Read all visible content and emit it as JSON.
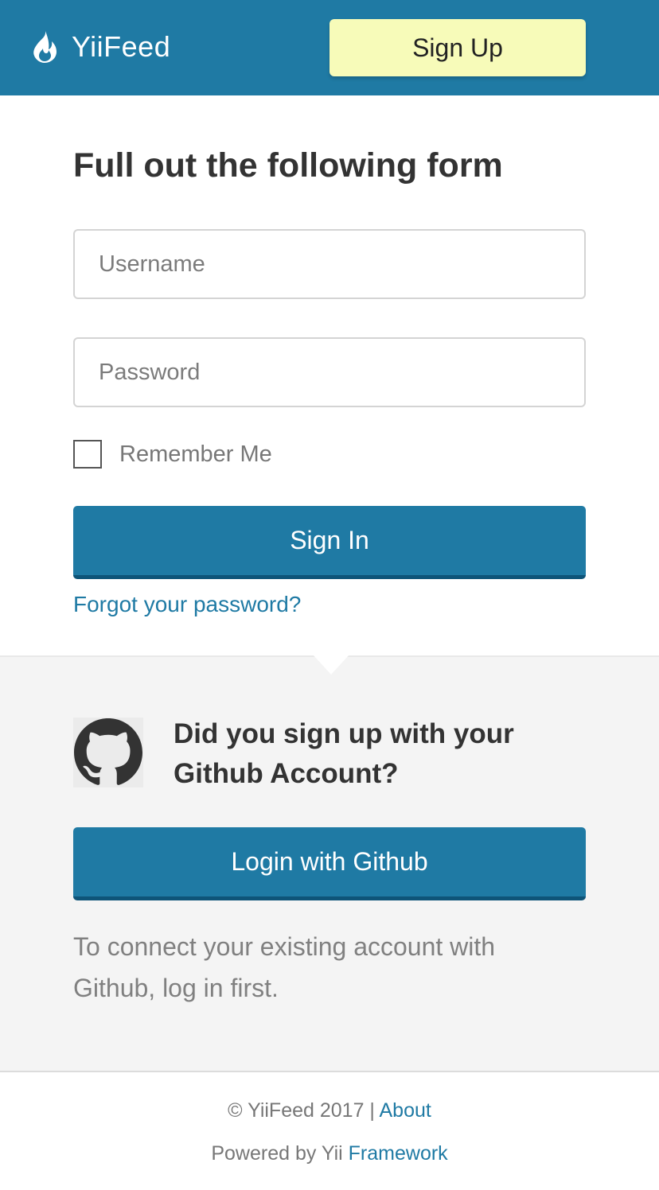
{
  "header": {
    "brand_name": "YiiFeed",
    "brand_icon": "flame-icon",
    "signup_label": "Sign Up",
    "colors": {
      "header_bg": "#1f7aa4",
      "signup_bg": "#f7fbb9"
    }
  },
  "login_form": {
    "title": "Full out the following form",
    "username_placeholder": "Username",
    "username_value": "",
    "password_placeholder": "Password",
    "password_value": "",
    "remember_label": "Remember Me",
    "remember_checked": false,
    "signin_label": "Sign In",
    "forgot_label": "Forgot your password?",
    "colors": {
      "primary": "#1f7aa4",
      "link": "#1f7aa4"
    }
  },
  "github": {
    "icon": "github-icon",
    "question": "Did you sign up with your Github Account?",
    "login_label": "Login with Github",
    "note": "To connect your existing account with Github, log in first.",
    "colors": {
      "section_bg": "#f4f4f4"
    }
  },
  "footer": {
    "copyright": "© YiiFeed 2017 |",
    "about_label": "About",
    "powered_prefix": "Powered by Yii",
    "framework_label": "Framework"
  }
}
